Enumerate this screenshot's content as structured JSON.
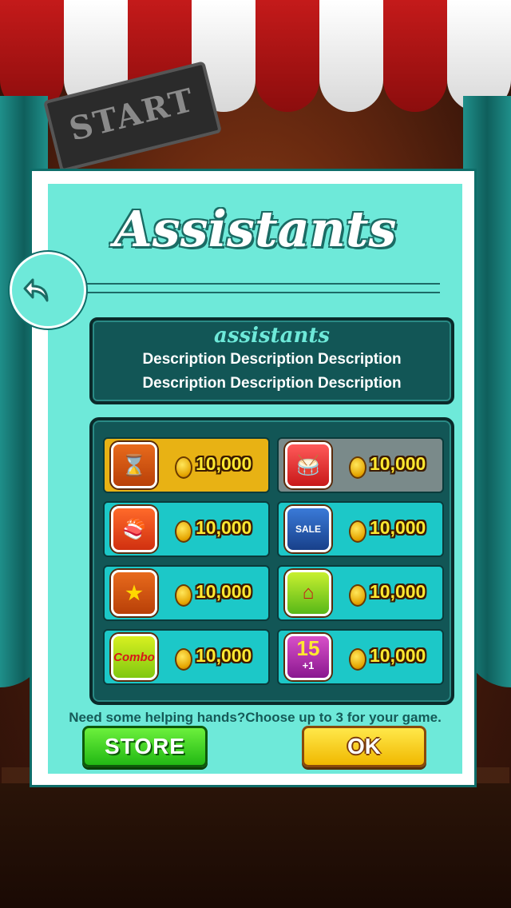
{
  "background": {
    "sign_text": "START"
  },
  "dialog": {
    "title": "Assistants",
    "description": {
      "title": "assistants",
      "line1": "Description Description Description",
      "line2": "Description Description Description"
    },
    "items": [
      {
        "icon": "hourglass-plus-icon",
        "price": "10,000",
        "state": "selected"
      },
      {
        "icon": "drum-icon",
        "price": "10,000",
        "state": "locked"
      },
      {
        "icon": "sushi-icon",
        "price": "10,000",
        "state": "normal"
      },
      {
        "icon": "sale-monster-icon",
        "price": "10,000",
        "state": "normal",
        "label": "SALE"
      },
      {
        "icon": "hourglass-star-icon",
        "price": "10,000",
        "state": "normal"
      },
      {
        "icon": "house-icon",
        "price": "10,000",
        "state": "normal"
      },
      {
        "icon": "combo-icon",
        "price": "10,000",
        "state": "normal",
        "label": "Combo"
      },
      {
        "icon": "plus15-icon",
        "price": "10,000",
        "state": "normal",
        "label": "15",
        "sublabel": "+1"
      }
    ],
    "hint": "Need some helping hands?Choose up to 3 for your game.",
    "store_label": "STORE",
    "ok_label": "OK"
  },
  "colors": {
    "panel": "#6ee9d9",
    "dark_teal": "#125656",
    "selected": "#e8b214",
    "locked": "#7a8a8a",
    "item": "#1cc8c8"
  }
}
